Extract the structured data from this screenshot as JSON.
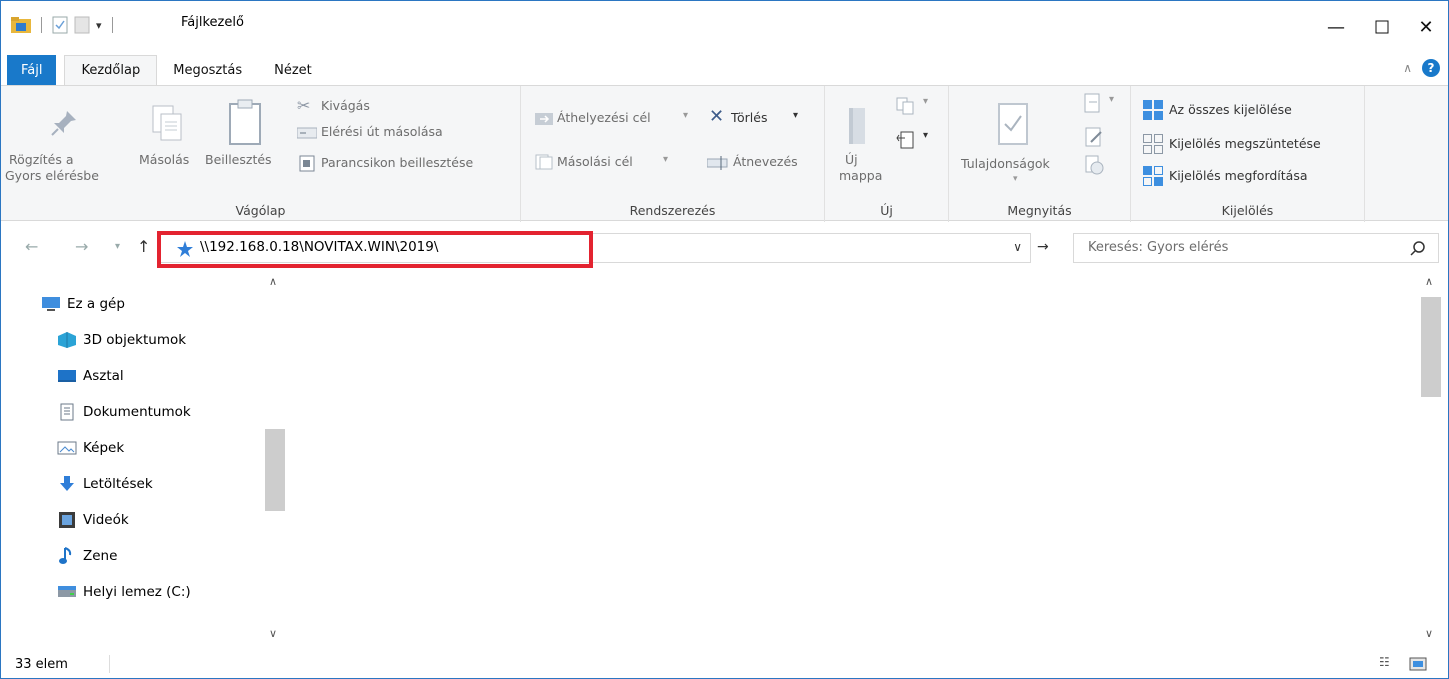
{
  "window": {
    "title": "Fájlkezelő"
  },
  "tabs": {
    "file": "Fájl",
    "home": "Kezdőlap",
    "share": "Megosztás",
    "view": "Nézet"
  },
  "ribbon": {
    "clipboard": {
      "label": "Vágólap",
      "pin": "Rögzítés a Gyors elérésbe",
      "pin_line1": "Rögzítés a",
      "pin_line2": "Gyors elérésbe",
      "copy": "Másolás",
      "paste": "Beillesztés",
      "cut": "Kivágás",
      "copy_path": "Elérési út másolása",
      "paste_shortcut": "Parancsikon beillesztése"
    },
    "organize": {
      "label": "Rendszerezés",
      "move_to": "Áthelyezési cél",
      "copy_to": "Másolási cél",
      "delete": "Törlés",
      "rename": "Átnevezés"
    },
    "new": {
      "label": "Új",
      "new_folder_line1": "Új",
      "new_folder_line2": "mappa"
    },
    "open": {
      "label": "Megnyitás",
      "properties": "Tulajdonságok"
    },
    "select": {
      "label": "Kijelölés",
      "select_all": "Az összes kijelölése",
      "select_none": "Kijelölés megszüntetése",
      "invert": "Kijelölés megfordítása"
    }
  },
  "address": {
    "path": "\\\\192.168.0.18\\NOVITAX.WIN\\2019\\"
  },
  "search": {
    "placeholder": "Keresés: Gyors elérés"
  },
  "navpane": {
    "items": [
      {
        "label": "Ez a gép",
        "icon": "monitor-icon"
      },
      {
        "label": "3D objektumok",
        "icon": "cube-icon"
      },
      {
        "label": "Asztal",
        "icon": "desktop-icon"
      },
      {
        "label": "Dokumentumok",
        "icon": "document-icon"
      },
      {
        "label": "Képek",
        "icon": "picture-icon"
      },
      {
        "label": "Letöltések",
        "icon": "download-icon"
      },
      {
        "label": "Videók",
        "icon": "video-icon"
      },
      {
        "label": "Zene",
        "icon": "music-icon"
      },
      {
        "label": "Helyi lemez (C:)",
        "icon": "drive-icon"
      }
    ]
  },
  "status": {
    "count": "33 elem"
  },
  "colors": {
    "accent": "#1979ca",
    "highlight": "#e32330"
  }
}
